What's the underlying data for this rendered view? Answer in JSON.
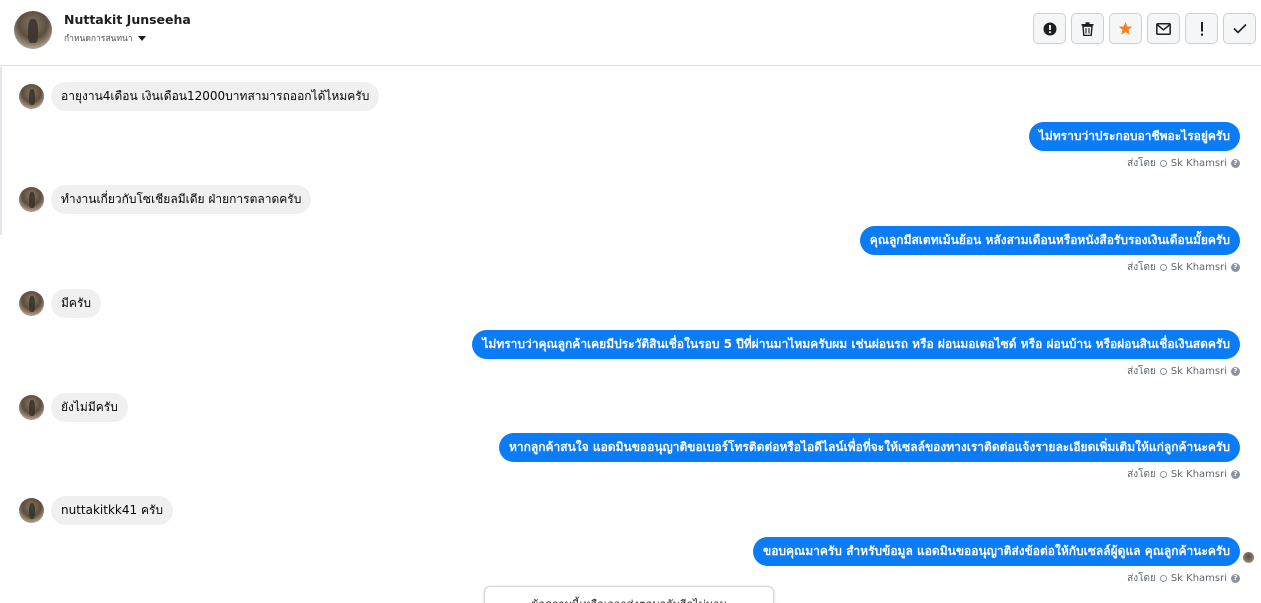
{
  "header": {
    "contact_name": "Nuttakit Junseeha",
    "subtitle": "กำหนดการสนทนา",
    "actions": [
      {
        "name": "report-icon",
        "tooltip": ""
      },
      {
        "name": "trash-icon",
        "tooltip": ""
      },
      {
        "name": "star-icon",
        "tooltip": ""
      },
      {
        "name": "mail-icon",
        "tooltip": ""
      },
      {
        "name": "exclamation-icon",
        "tooltip": ""
      },
      {
        "name": "check-icon",
        "tooltip": ""
      }
    ],
    "star_color": "#f5821f"
  },
  "messages": [
    {
      "direction": "in",
      "text": "อายุงาน4เดือน เงินเดือน12000บาทสามารถออกได้ไหมครับ"
    },
    {
      "direction": "out",
      "text": "ไม่ทราบว่าประกอบอาชีพอะไรอยู่ครับ",
      "sent_by_prefix": "ส่งโดย",
      "sender": "Sk Khamsri"
    },
    {
      "direction": "in",
      "text": "ทำงานเกี่ยวกับโซเชียลมีเดีย ฝ่ายการตลาดครับ"
    },
    {
      "direction": "out",
      "text": "คุณลูกมีสเตทเม้นย้อน หลังสามเดือนหรือหนังสือรับรองเงินเดือนมั้ยครับ",
      "sent_by_prefix": "ส่งโดย",
      "sender": "Sk Khamsri"
    },
    {
      "direction": "in",
      "text": "มีครับ"
    },
    {
      "direction": "out",
      "text": "ไม่ทราบว่าคุณลูกค้าเคยมีประวัติสินเชื่อในรอบ 5 ปีที่ผ่านมาไหมครับผม เช่นผ่อนรถ หรือ ผ่อนมอเตอไซด์ หรือ ผ่อนบ้าน หรือผ่อนสินเชื่อเงินสดครับ",
      "sent_by_prefix": "ส่งโดย",
      "sender": "Sk Khamsri"
    },
    {
      "direction": "in",
      "text": "ยังไม่มีครับ"
    },
    {
      "direction": "out",
      "text": "หากลูกค้าสนใจ แอดมินขออนุญาติขอเบอร์โทรติดต่อหรือไอดีไลน์เพื่อที่จะให้เซลล์ของทางเราติดต่อแจ้งรายละเอียดเพิ่มเติมให้แก่ลูกค้านะครับ",
      "sent_by_prefix": "ส่งโดย",
      "sender": "Sk Khamsri"
    },
    {
      "direction": "in",
      "text": "nuttakitkk41 ครับ"
    },
    {
      "direction": "out",
      "text": "ขอบคุณมาครับ สำหรับข้อมูล แอดมินขออนุญาติส่งข้อต่อให้กับเซลล์ผู้ดูแล คุณลูกค้านะครับ",
      "sent_by_prefix": "ส่งโดย",
      "sender": "Sk Khamsri"
    }
  ],
  "bottom_popup": "ข้อความนี้เหลือเวลาส่งตอบกลับอีกไม่นาน"
}
